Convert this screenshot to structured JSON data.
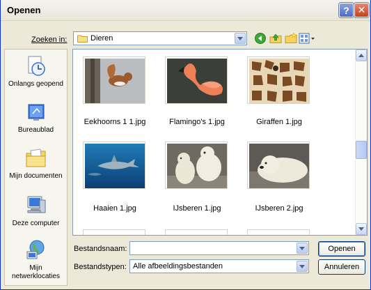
{
  "window": {
    "title": "Openen"
  },
  "lookin": {
    "label": "Zoeken in:",
    "value": "Dieren"
  },
  "places": [
    {
      "label": "Onlangs geopend"
    },
    {
      "label": "Bureaublad"
    },
    {
      "label": "Mijn documenten"
    },
    {
      "label": "Deze computer"
    },
    {
      "label": "Mijn netwerklocaties"
    }
  ],
  "files": [
    {
      "name": "Eekhoorns 1 1.jpg",
      "icon": "squirrel-photo"
    },
    {
      "name": "Flamingo's 1.jpg",
      "icon": "flamingo-photo"
    },
    {
      "name": "Giraffen 1.jpg",
      "icon": "giraffe-photo"
    },
    {
      "name": "Haaien 1.jpg",
      "icon": "shark-photo"
    },
    {
      "name": "IJsberen 1.jpg",
      "icon": "polar-bears-photo"
    },
    {
      "name": "IJsberen 2.jpg",
      "icon": "polar-bear-photo"
    }
  ],
  "form": {
    "filename_label": "Bestandsnaam:",
    "filename_value": "",
    "filetype_label": "Bestandstypen:",
    "filetype_value": "Alle afbeeldingsbestanden",
    "open_button": "Openen",
    "cancel_button": "Annuleren"
  },
  "colors": {
    "accent": "#0831D9",
    "dialog_bg": "#ECE9D8",
    "close_red": "#c5411d"
  }
}
